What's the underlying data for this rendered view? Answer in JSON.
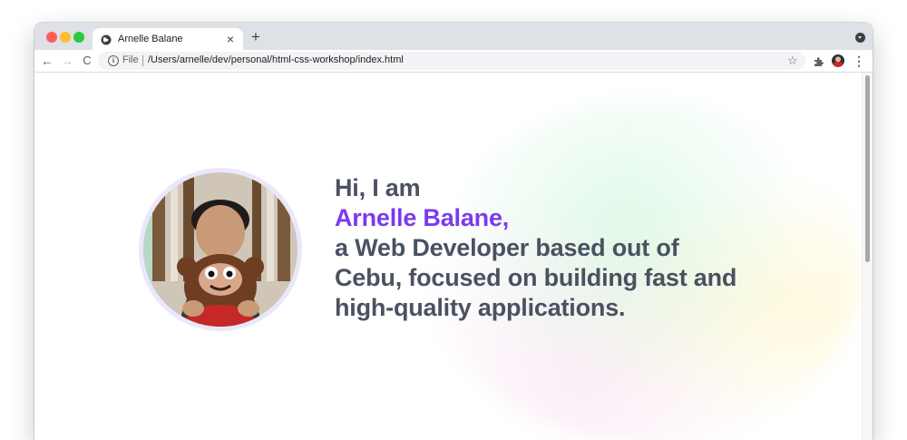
{
  "browser": {
    "tab_title": "Arnelle Balane",
    "tab_close": "×",
    "new_tab": "+",
    "nav": {
      "back": "←",
      "forward": "→",
      "reload": "C"
    },
    "address_bar": {
      "info": "i",
      "scheme_label": "File",
      "url": "/Users/arnelle/dev/personal/html-css-workshop/index.html"
    },
    "star": "☆",
    "menu": "⋮"
  },
  "page": {
    "greeting": "Hi, I am",
    "name": "Arnelle Balane,",
    "intro_lines": [
      "a Web Developer based out of",
      "Cebu, focused on building fast and",
      "high-quality applications."
    ]
  },
  "colors": {
    "accent": "#7c3aed",
    "text": "#4a5261",
    "avatar_ring": "#ebe7fb"
  },
  "icons": [
    "globe-icon",
    "close-icon",
    "plus-icon",
    "back-arrow-icon",
    "forward-arrow-icon",
    "reload-icon",
    "info-icon",
    "star-icon",
    "puzzle-extension-icon",
    "kebab-menu-icon"
  ]
}
